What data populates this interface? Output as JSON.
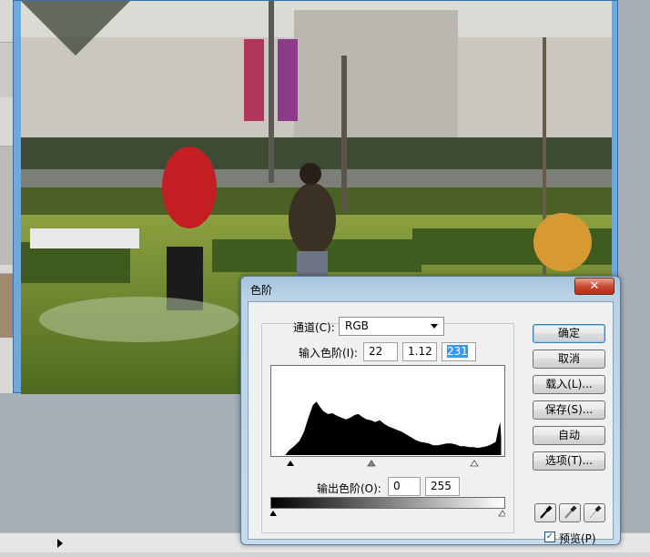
{
  "dialog": {
    "title": "色阶",
    "close": "✕",
    "channel_label": "通道(C):",
    "channel_value": "RGB",
    "input_levels_label": "输入色阶(I):",
    "input_black": "22",
    "input_gamma": "1.12",
    "input_white": "231",
    "output_levels_label": "输出色阶(O):",
    "output_black": "0",
    "output_white": "255",
    "buttons": {
      "ok": "确定",
      "cancel": "取消",
      "load": "载入(L)...",
      "save": "保存(S)...",
      "auto": "自动",
      "options": "选项(T)..."
    },
    "preview_label": "预览(P)",
    "preview_checked": true
  },
  "colors": {
    "title_bar": "#b9d2e6",
    "close_button": "#c8452c",
    "selection": "#3399ff"
  },
  "icons": [
    "eyedropper-black-icon",
    "eyedropper-gray-icon",
    "eyedropper-white-icon",
    "close-icon",
    "arrow-right-icon"
  ]
}
